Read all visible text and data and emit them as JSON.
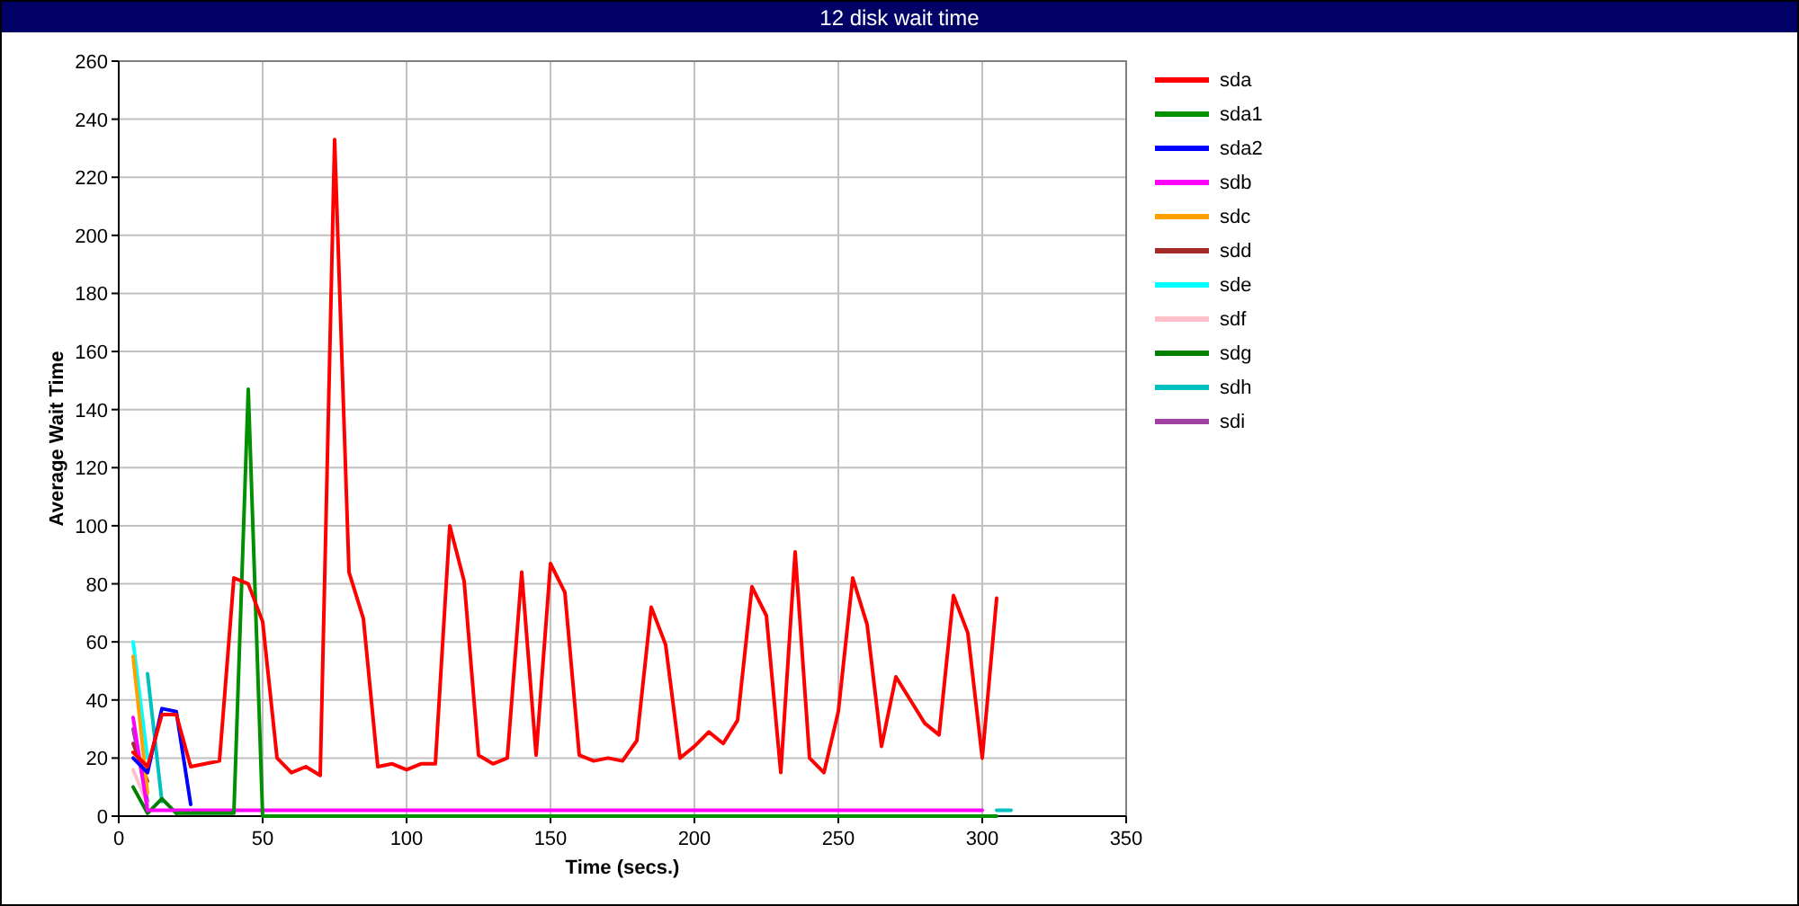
{
  "window": {
    "title": "12 disk wait time"
  },
  "chart": {
    "chart_data": {
      "type": "line",
      "xlabel": "Time (secs.)",
      "ylabel": "Average Wait Time",
      "grid": true,
      "x": [
        5,
        10,
        15,
        20,
        25,
        30,
        35,
        40,
        45,
        50,
        55,
        60,
        65,
        70,
        75,
        80,
        85,
        90,
        95,
        100,
        105,
        110,
        115,
        120,
        125,
        130,
        135,
        140,
        145,
        150,
        155,
        160,
        165,
        170,
        175,
        180,
        185,
        190,
        195,
        200,
        205,
        210,
        215,
        220,
        225,
        230,
        235,
        240,
        245,
        250,
        255,
        260,
        265,
        270,
        275,
        280,
        285,
        290,
        295,
        300,
        305,
        310
      ],
      "xlim": [
        0,
        350
      ],
      "ylim": [
        0,
        260
      ],
      "xticks": [
        0,
        50,
        100,
        150,
        200,
        250,
        300,
        350
      ],
      "yticks": [
        0,
        20,
        40,
        60,
        80,
        100,
        120,
        140,
        160,
        180,
        200,
        220,
        240,
        260
      ],
      "series": [
        {
          "name": "sda",
          "color": "#ff0000",
          "values": [
            22,
            17,
            35,
            35,
            17,
            18,
            19,
            82,
            80,
            67,
            20,
            15,
            17,
            14,
            233,
            84,
            68,
            17,
            18,
            16,
            18,
            18,
            100,
            81,
            21,
            18,
            20,
            84,
            21,
            87,
            77,
            21,
            19,
            20,
            19,
            26,
            72,
            59,
            20,
            24,
            29,
            25,
            33,
            79,
            69,
            15,
            91,
            20,
            15,
            36,
            82,
            66,
            24,
            48,
            40,
            32,
            28,
            76,
            63,
            20,
            75,
            null
          ]
        },
        {
          "name": "sda1",
          "color": "#009000",
          "values": [
            null,
            null,
            null,
            1,
            1,
            1,
            1,
            1,
            147,
            0,
            0,
            0,
            0,
            0,
            0,
            0,
            0,
            0,
            0,
            0,
            0,
            0,
            0,
            0,
            0,
            0,
            0,
            0,
            0,
            0,
            0,
            0,
            0,
            0,
            0,
            0,
            0,
            0,
            0,
            0,
            0,
            0,
            0,
            0,
            0,
            0,
            0,
            0,
            0,
            0,
            0,
            0,
            0,
            0,
            0,
            0,
            0,
            0,
            0,
            0,
            0,
            null
          ]
        },
        {
          "name": "sda2",
          "color": "#0000ff",
          "values": [
            20,
            15,
            37,
            36,
            4,
            null,
            null,
            null,
            null,
            null,
            null,
            null,
            null,
            null,
            null,
            null,
            null,
            null,
            null,
            null,
            null,
            null,
            null,
            null,
            null,
            null,
            null,
            null,
            null,
            null,
            null,
            null,
            null,
            null,
            null,
            null,
            null,
            null,
            null,
            null,
            null,
            null,
            null,
            null,
            null,
            null,
            null,
            null,
            null,
            null,
            null,
            null,
            null,
            null,
            null,
            null,
            null,
            null,
            null,
            null,
            null,
            null
          ]
        },
        {
          "name": "sdb",
          "color": "#ff00ff",
          "values": [
            34,
            2,
            2,
            2,
            2,
            2,
            2,
            2,
            2,
            2,
            2,
            2,
            2,
            2,
            2,
            2,
            2,
            2,
            2,
            2,
            2,
            2,
            2,
            2,
            2,
            2,
            2,
            2,
            2,
            2,
            2,
            2,
            2,
            2,
            2,
            2,
            2,
            2,
            2,
            2,
            2,
            2,
            2,
            2,
            2,
            2,
            2,
            2,
            2,
            2,
            2,
            2,
            2,
            2,
            2,
            2,
            2,
            2,
            2,
            2,
            null,
            null
          ]
        },
        {
          "name": "sdc",
          "color": "#ffa000",
          "values": [
            55,
            8,
            null,
            null,
            null,
            null,
            null,
            null,
            null,
            null,
            null,
            null,
            null,
            null,
            null,
            null,
            null,
            null,
            null,
            null,
            null,
            null,
            null,
            null,
            null,
            null,
            null,
            null,
            null,
            null,
            null,
            null,
            null,
            null,
            null,
            null,
            null,
            null,
            null,
            null,
            null,
            null,
            null,
            null,
            null,
            null,
            null,
            null,
            null,
            null,
            null,
            null,
            null,
            null,
            null,
            null,
            null,
            null,
            null,
            null,
            null,
            null
          ]
        },
        {
          "name": "sdd",
          "color": "#a52a2a",
          "values": [
            25,
            12,
            null,
            null,
            null,
            null,
            null,
            null,
            null,
            null,
            null,
            null,
            null,
            null,
            null,
            null,
            null,
            null,
            null,
            null,
            null,
            null,
            null,
            null,
            null,
            null,
            null,
            null,
            null,
            null,
            null,
            null,
            null,
            null,
            null,
            null,
            null,
            null,
            null,
            null,
            null,
            null,
            null,
            null,
            null,
            null,
            null,
            null,
            null,
            null,
            null,
            null,
            null,
            null,
            null,
            null,
            null,
            null,
            null,
            null,
            null,
            null
          ]
        },
        {
          "name": "sde",
          "color": "#00ffff",
          "values": [
            60,
            20,
            null,
            null,
            null,
            null,
            null,
            null,
            null,
            null,
            null,
            null,
            null,
            null,
            null,
            null,
            null,
            null,
            null,
            null,
            null,
            null,
            null,
            null,
            null,
            null,
            null,
            null,
            null,
            null,
            null,
            null,
            null,
            null,
            null,
            null,
            null,
            null,
            null,
            null,
            null,
            null,
            null,
            null,
            null,
            null,
            null,
            null,
            null,
            null,
            null,
            null,
            null,
            null,
            null,
            null,
            null,
            null,
            null,
            null,
            null,
            null
          ]
        },
        {
          "name": "sdf",
          "color": "#ffc0cb",
          "values": [
            16,
            4,
            null,
            null,
            null,
            null,
            null,
            null,
            null,
            null,
            null,
            null,
            null,
            null,
            null,
            null,
            null,
            null,
            null,
            null,
            null,
            null,
            null,
            null,
            null,
            null,
            null,
            null,
            null,
            null,
            null,
            null,
            null,
            null,
            null,
            null,
            null,
            null,
            null,
            null,
            null,
            null,
            null,
            null,
            null,
            null,
            null,
            null,
            null,
            null,
            null,
            null,
            null,
            null,
            null,
            null,
            null,
            null,
            null,
            null,
            null,
            null
          ]
        },
        {
          "name": "sdg",
          "color": "#008000",
          "values": [
            10,
            1,
            6,
            1,
            null,
            null,
            null,
            null,
            null,
            null,
            null,
            null,
            null,
            null,
            null,
            null,
            null,
            null,
            null,
            null,
            null,
            null,
            null,
            null,
            null,
            null,
            null,
            null,
            null,
            null,
            null,
            null,
            null,
            null,
            null,
            null,
            null,
            null,
            null,
            null,
            null,
            null,
            null,
            null,
            null,
            null,
            null,
            null,
            null,
            null,
            null,
            null,
            null,
            null,
            null,
            null,
            null,
            null,
            null,
            null,
            null,
            null
          ]
        },
        {
          "name": "sdh",
          "color": "#00c0c0",
          "values": [
            null,
            49,
            5,
            null,
            null,
            null,
            null,
            null,
            null,
            null,
            null,
            null,
            null,
            null,
            null,
            null,
            null,
            null,
            null,
            null,
            null,
            null,
            null,
            null,
            null,
            null,
            null,
            null,
            null,
            null,
            null,
            null,
            null,
            null,
            null,
            null,
            null,
            null,
            null,
            null,
            null,
            null,
            null,
            null,
            null,
            null,
            null,
            null,
            null,
            null,
            null,
            null,
            null,
            null,
            null,
            null,
            null,
            null,
            null,
            null,
            2,
            2
          ]
        },
        {
          "name": "sdi",
          "color": "#a040a0",
          "values": [
            30,
            5,
            null,
            null,
            null,
            null,
            null,
            null,
            null,
            null,
            null,
            null,
            null,
            null,
            null,
            null,
            null,
            null,
            null,
            null,
            null,
            null,
            null,
            null,
            null,
            null,
            null,
            null,
            null,
            null,
            null,
            null,
            null,
            null,
            null,
            null,
            null,
            null,
            null,
            null,
            null,
            null,
            null,
            null,
            null,
            null,
            null,
            null,
            null,
            null,
            null,
            null,
            null,
            null,
            null,
            null,
            null,
            null,
            null,
            null,
            null,
            null
          ]
        }
      ]
    }
  }
}
